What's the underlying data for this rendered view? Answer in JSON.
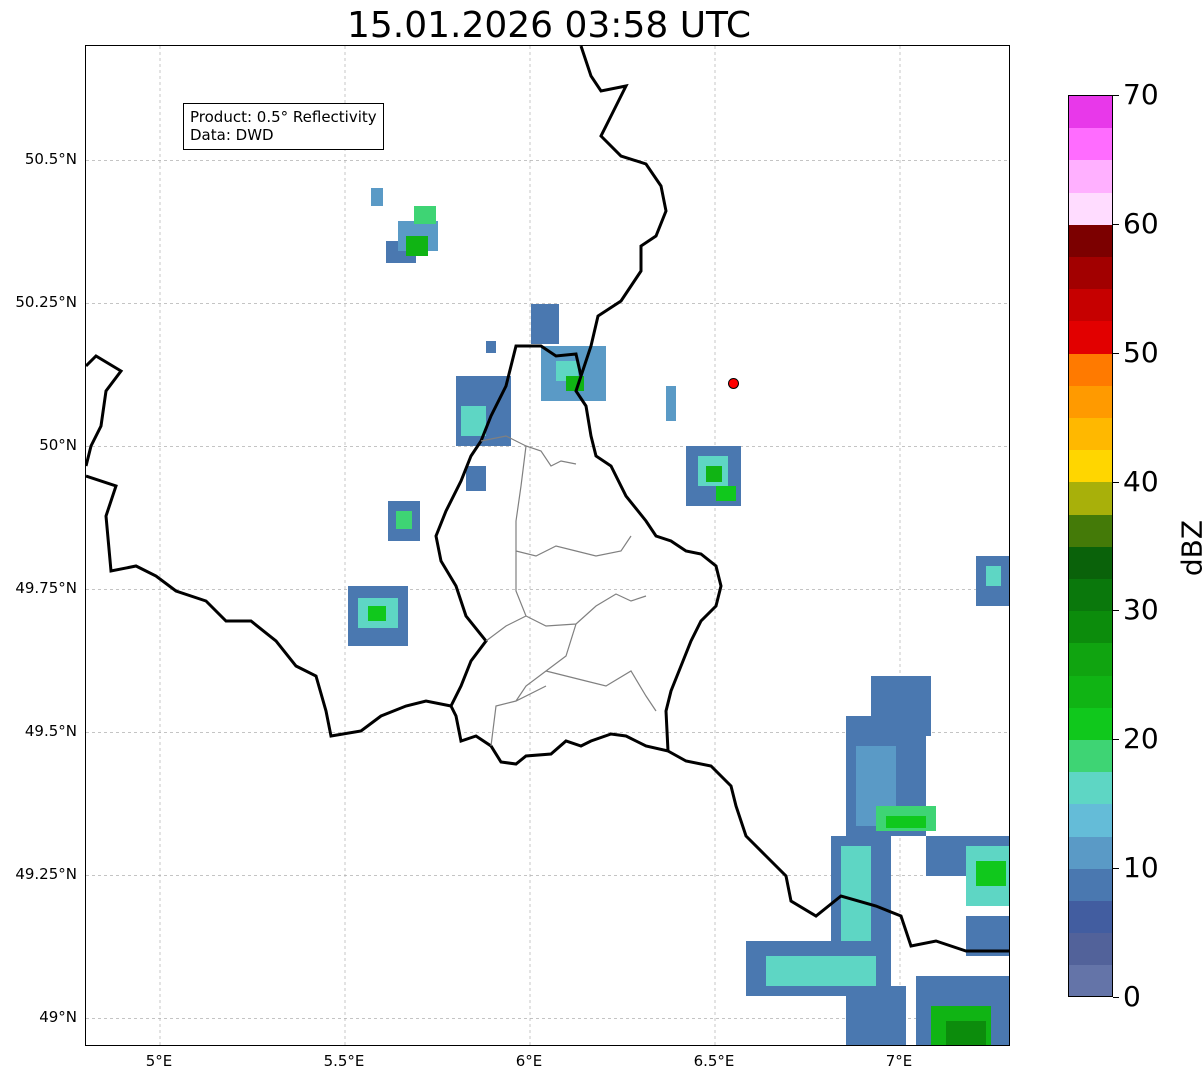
{
  "title": "15.01.2026 03:58 UTC",
  "info_box": {
    "product": "Product: 0.5° Reflectivity",
    "data": "Data: DWD"
  },
  "axes": {
    "lat_ticks": [
      "50.5°N",
      "50.25°N",
      "50°N",
      "49.75°N",
      "49.5°N",
      "49.25°N",
      "49°N"
    ],
    "lat_values": [
      50.5,
      50.25,
      50.0,
      49.75,
      49.5,
      49.25,
      49.0
    ],
    "lon_ticks": [
      "5°E",
      "5.5°E",
      "6°E",
      "6.5°E",
      "7°E"
    ],
    "lon_values": [
      5.0,
      5.5,
      6.0,
      6.5,
      7.0
    ],
    "lon_range": [
      4.8,
      7.3
    ],
    "lat_range": [
      48.95,
      50.7
    ],
    "grid": true
  },
  "colorbar": {
    "label": "dBZ",
    "range": [
      0,
      70
    ],
    "tick_labels": [
      "0",
      "10",
      "20",
      "30",
      "40",
      "50",
      "60",
      "70"
    ],
    "tick_values": [
      0,
      10,
      20,
      30,
      40,
      50,
      60,
      70
    ],
    "colors": [
      "#6474a8",
      "#52629a",
      "#425da0",
      "#4a78b0",
      "#5a9ac6",
      "#64bcd8",
      "#5ed6c4",
      "#3ed474",
      "#10c81c",
      "#10b414",
      "#10a410",
      "#0c8c0c",
      "#0a780c",
      "#0a620a",
      "#447a08",
      "#a8b00a",
      "#ffd600",
      "#ffb800",
      "#ff9a00",
      "#ff7a00",
      "#e20000",
      "#c60000",
      "#a20000",
      "#7c0000",
      "#ffdcff",
      "#ffb0ff",
      "#ff6cff",
      "#e838ea"
    ]
  },
  "marker": {
    "lon": 6.55,
    "lat": 50.11,
    "color": "#ff0000"
  },
  "colors": {
    "international_border": "#000000",
    "admin_border": "#808080",
    "grid": "#b0b0b0"
  }
}
